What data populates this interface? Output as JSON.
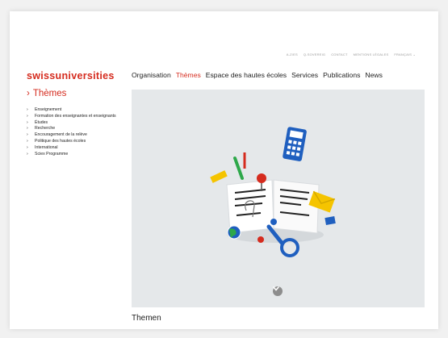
{
  "utility_nav": [
    "A-Z/ES",
    "Q-SOVEREIG",
    "CONTACT",
    "MENTIONS LÉGALES",
    "FRANÇAIS ⌄"
  ],
  "logo": "swissuniversities",
  "main_nav": [
    {
      "label": "Organisation",
      "active": false
    },
    {
      "label": "Thèmes",
      "active": true
    },
    {
      "label": "Espace des hautes écoles",
      "active": false
    },
    {
      "label": "Services",
      "active": false
    },
    {
      "label": "Publications",
      "active": false
    },
    {
      "label": "News",
      "active": false
    }
  ],
  "section_title": "Thèmes",
  "sidebar_items": [
    "Enseignement",
    "Formation des enseignantes et enseignants",
    "Études",
    "Recherche",
    "Encouragement de la relève",
    "Politique des hautes écoles",
    "International",
    "Sciex Programme"
  ],
  "page_title": "Themen",
  "colors": {
    "brand": "#d52b1e",
    "hero_bg": "#e5e8ea",
    "accent_blue": "#1f5fbf",
    "accent_yellow": "#f5c400",
    "accent_green": "#2ea84a"
  },
  "icons": {
    "scroll_down": "chevron-down-icon",
    "sidebar_bullet": "chevron-right-icon"
  }
}
